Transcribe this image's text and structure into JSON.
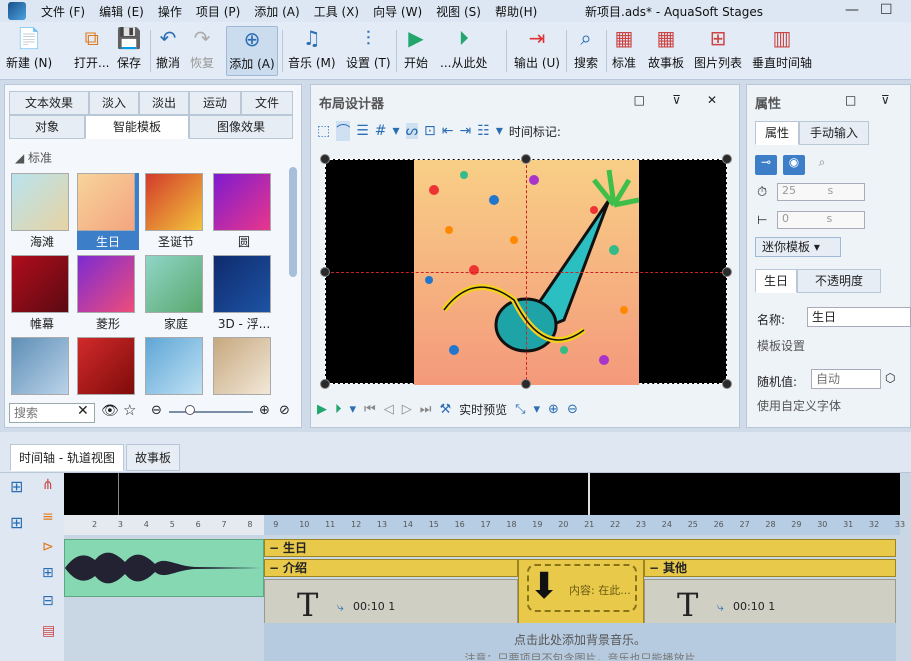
{
  "app": {
    "menu": [
      "文件 (F)",
      "编辑 (E)",
      "操作",
      "项目 (P)",
      "添加 (A)",
      "工具 (X)",
      "向导 (W)",
      "视图 (S)",
      "帮助(H)"
    ],
    "title": "新项目.ads* - AquaSoft Stages",
    "window_controls": [
      "—",
      "☐"
    ]
  },
  "toolbar": {
    "new": "新建 (N)",
    "open": "打开...",
    "save": "保存",
    "undo": "撤消",
    "redo": "恢复",
    "add": "添加 (A)",
    "music": "音乐 (M)",
    "settings": "设置 (T)",
    "start": "开始",
    "from_here": "...从此处",
    "export": "输出 (U)",
    "search": "搜索",
    "standard": "标准",
    "storyboard": "故事板",
    "image_list": "图片列表",
    "vertical_timeline": "垂直时间轴"
  },
  "left_panel": {
    "tabs_top": [
      "文本效果",
      "淡入",
      "淡出",
      "运动",
      "文件"
    ],
    "tabs_bottom": [
      "对象",
      "智能模板",
      "图像效果"
    ],
    "selected_tab": "智能模板",
    "section": "标准",
    "thumbs": [
      {
        "label": "海滩",
        "color1": "#b9e3ee",
        "color2": "#e6d3a3"
      },
      {
        "label": "生日",
        "color1": "#f7d49a",
        "color2": "#f4a47f"
      },
      {
        "label": "圣诞节",
        "color1": "#d23b2b",
        "color2": "#f3c53b"
      },
      {
        "label": "圆",
        "color1": "#7e1bd0",
        "color2": "#e9368b"
      },
      {
        "label": "帷幕",
        "color1": "#b10d1c",
        "color2": "#5b0a12"
      },
      {
        "label": "菱形",
        "color1": "#7d2bd2",
        "color2": "#ee4d7a"
      },
      {
        "label": "家庭",
        "color1": "#8fd6c7",
        "color2": "#5aa86e"
      },
      {
        "label": "3D - 浮...",
        "color1": "#0f2b6e",
        "color2": "#1d53a3"
      },
      {
        "label": "",
        "color1": "#5f8fb6",
        "color2": "#b9d3ea"
      },
      {
        "label": "",
        "color1": "#d12a2a",
        "color2": "#7f0b0b"
      },
      {
        "label": "",
        "color1": "#5fa6d6",
        "color2": "#bfe1f4"
      },
      {
        "label": "",
        "color1": "#c6a87e",
        "color2": "#f2e8d8"
      }
    ],
    "search_placeholder": "搜索"
  },
  "center_panel": {
    "title": "布局设计器",
    "time_marker_label": "时间标记:",
    "realtime_preview": "实时预览"
  },
  "right_panel": {
    "title": "属性",
    "tabs": [
      "属性",
      "手动输入"
    ],
    "duration_value": "25",
    "duration_unit": "s",
    "offset_value": "0",
    "mini_template": "迷你模板",
    "sub_tabs": [
      "生日",
      "不透明度"
    ],
    "name_label": "名称:",
    "name_value": "生日",
    "template_settings": "模板设置",
    "random_label": "随机值:",
    "random_value": "自动",
    "custom_font": "使用自定义字体"
  },
  "timeline": {
    "tabs": [
      "时间轴 - 轨道视图",
      "故事板"
    ],
    "ruler_ticks": [
      "2",
      "3",
      "4",
      "5",
      "6",
      "7",
      "8",
      "9",
      "10",
      "11",
      "12",
      "13",
      "14",
      "15",
      "16",
      "17",
      "18",
      "19",
      "20",
      "21",
      "22",
      "23",
      "24",
      "25",
      "26",
      "27",
      "28",
      "29",
      "30",
      "31",
      "32",
      "33"
    ],
    "group_label": "生日",
    "clip_intro": "介绍",
    "clip_other": "其他",
    "clip_content": "内容: 在此...",
    "clip_time_1": "00:10 1",
    "clip_time_2": "00:10 1",
    "bg_music_hint": "点击此处添加背景音乐。",
    "bg_music_note": "注意：只要项目不包含图片，音乐也只能播放片"
  }
}
